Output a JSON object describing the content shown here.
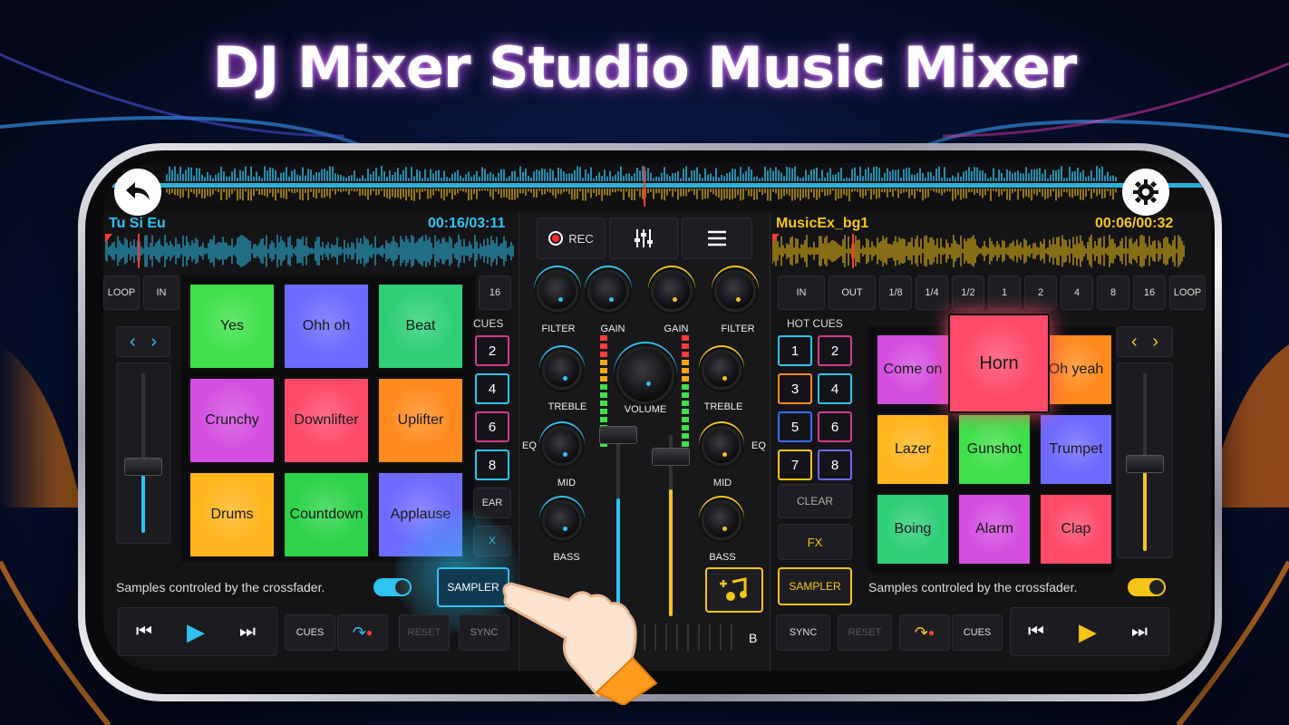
{
  "headline": "DJ Mixer Studio Music Mixer",
  "colors": {
    "deckA": "#2ec3f0",
    "deckB": "#f5c518",
    "accent": "#ff3b3b"
  },
  "nav": {
    "back_icon": "back-arrow-icon",
    "settings_icon": "gear-icon"
  },
  "deckA": {
    "track": "Tu Si Eu",
    "time": "00:16/03:11",
    "loop": {
      "loop_label": "LOOP",
      "in_label": "IN",
      "sixteen": "16"
    },
    "cues_label": "CUES",
    "cues": [
      "2",
      "4",
      "6",
      "8"
    ],
    "clear_label": "EAR",
    "fx_label": "X",
    "pads": [
      {
        "label": "Yes",
        "color": "#3fe04a"
      },
      {
        "label": "Ohh oh",
        "color": "#6b6bff"
      },
      {
        "label": "Beat",
        "color": "#2fcf78"
      },
      {
        "label": "Crunchy",
        "color": "#d44fe0"
      },
      {
        "label": "Downlifter",
        "color": "#ff4a6a"
      },
      {
        "label": "Uplifter",
        "color": "#ff8a1e"
      },
      {
        "label": "Drums",
        "color": "#ffb51e"
      },
      {
        "label": "Countdown",
        "color": "#2ed34a"
      },
      {
        "label": "Applause",
        "color": "#6f6aff"
      }
    ],
    "samples_note": "Samples controled by the crossfader.",
    "sampler_label": "SAMPLER",
    "transport": {
      "cues_label": "CUES",
      "reset_label": "RESET",
      "sync_label": "SYNC"
    }
  },
  "mixer": {
    "rec_label": "REC",
    "filter_left": "FILTER",
    "gain_left": "GAIN",
    "gain_right": "GAIN",
    "filter_right": "FILTER",
    "treble_left": "TREBLE",
    "volume": "VOLUME",
    "treble_right": "TREBLE",
    "eq_left": "EQ",
    "eq_right": "EQ",
    "mid_left": "MID",
    "mid_right": "MID",
    "bass_left": "BASS",
    "bass_right": "BASS",
    "crossfader_b": "B",
    "fader_levels": {
      "left": 0.35,
      "right": 0.3
    }
  },
  "deckB": {
    "track": "MusicEx_bg1",
    "time": "00:06/00:32",
    "loop": [
      "IN",
      "OUT",
      "1/8",
      "1/4",
      "1/2",
      "1",
      "2",
      "4",
      "8",
      "16",
      "LOOP"
    ],
    "hotcues_label": "HOT CUES",
    "hotcues": [
      "1",
      "2",
      "3",
      "4",
      "5",
      "6",
      "7",
      "8"
    ],
    "clear_label": "CLEAR",
    "fx_label": "FX",
    "sampler_label": "SAMPLER",
    "pads": [
      {
        "label": "Come on",
        "color": "#d44fe0"
      },
      {
        "label": "Horn",
        "color": "#ff4a6a"
      },
      {
        "label": "Oh yeah",
        "color": "#ff8a1e"
      },
      {
        "label": "Lazer",
        "color": "#ffb51e"
      },
      {
        "label": "Gunshot",
        "color": "#3fe04a"
      },
      {
        "label": "Trumpet",
        "color": "#6f6aff"
      },
      {
        "label": "Boing",
        "color": "#2fcf78"
      },
      {
        "label": "Alarm",
        "color": "#d44fe0"
      },
      {
        "label": "Clap",
        "color": "#ff4a6a"
      }
    ],
    "samples_note": "Samples controled by the crossfader.",
    "transport": {
      "sync_label": "SYNC",
      "reset_label": "RESET",
      "cues_label": "CUES"
    }
  }
}
